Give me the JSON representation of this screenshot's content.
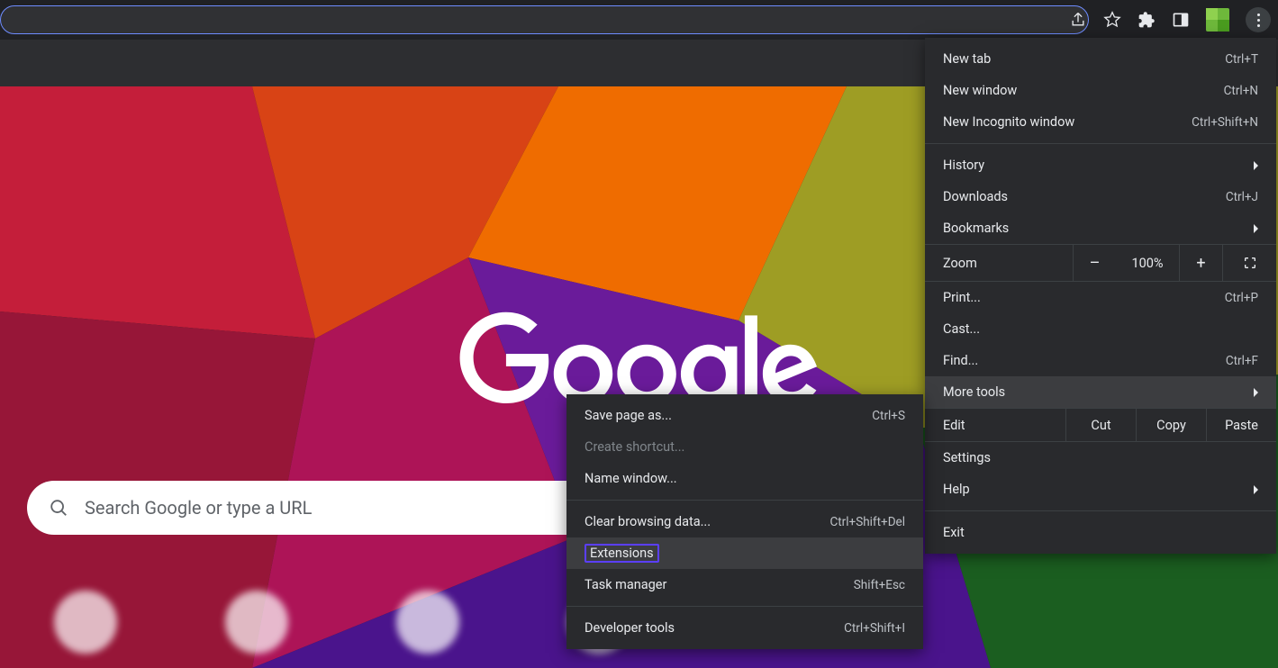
{
  "toolbar": {
    "share_icon": "share-icon",
    "star_icon": "star-icon",
    "extensions_icon": "puzzle-icon",
    "sidepanel_icon": "panel-icon",
    "menu_icon": "kebab-icon"
  },
  "content": {
    "logo_text": "Google",
    "search_placeholder": "Search Google or type a URL"
  },
  "menu": {
    "items_top": [
      {
        "label": "New tab",
        "shortcut": "Ctrl+T"
      },
      {
        "label": "New window",
        "shortcut": "Ctrl+N"
      },
      {
        "label": "New Incognito window",
        "shortcut": "Ctrl+Shift+N"
      }
    ],
    "items_nav": [
      {
        "label": "History",
        "arrow": true
      },
      {
        "label": "Downloads",
        "shortcut": "Ctrl+J"
      },
      {
        "label": "Bookmarks",
        "arrow": true
      }
    ],
    "zoom": {
      "label": "Zoom",
      "minus": "–",
      "value": "100%",
      "plus": "+"
    },
    "items_mid": [
      {
        "label": "Print...",
        "shortcut": "Ctrl+P"
      },
      {
        "label": "Cast..."
      },
      {
        "label": "Find...",
        "shortcut": "Ctrl+F"
      },
      {
        "label": "More tools",
        "arrow": true,
        "hover": true
      }
    ],
    "edit": {
      "label": "Edit",
      "cut": "Cut",
      "copy": "Copy",
      "paste": "Paste"
    },
    "items_bottom": [
      {
        "label": "Settings"
      },
      {
        "label": "Help",
        "arrow": true
      }
    ],
    "exit": {
      "label": "Exit"
    }
  },
  "submenu": {
    "items": [
      {
        "label": "Save page as...",
        "shortcut": "Ctrl+S"
      },
      {
        "label": "Create shortcut...",
        "disabled": true
      },
      {
        "label": "Name window..."
      }
    ],
    "items2": [
      {
        "label": "Clear browsing data...",
        "shortcut": "Ctrl+Shift+Del"
      },
      {
        "label": "Extensions",
        "highlight": true
      },
      {
        "label": "Task manager",
        "shortcut": "Shift+Esc"
      }
    ],
    "items3": [
      {
        "label": "Developer tools",
        "shortcut": "Ctrl+Shift+I"
      }
    ]
  }
}
